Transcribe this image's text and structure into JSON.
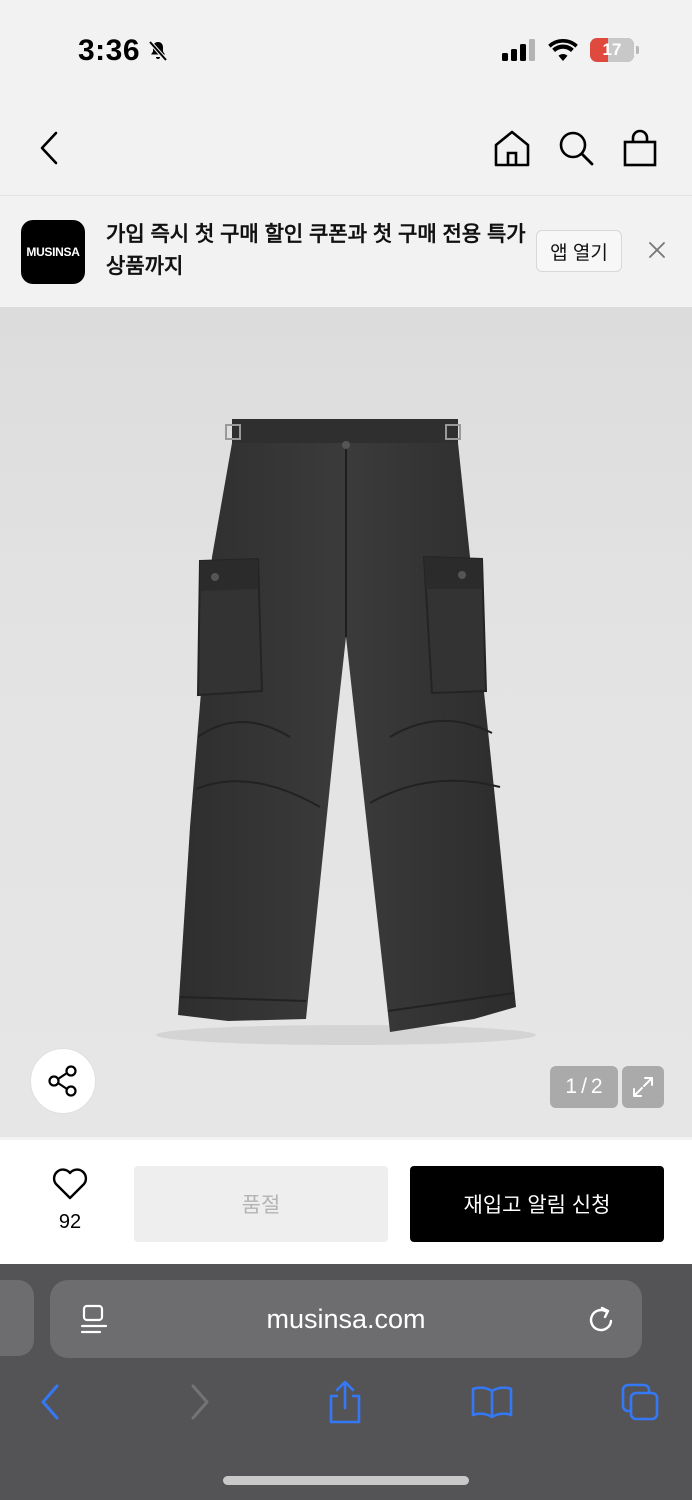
{
  "status_bar": {
    "time": "3:36",
    "battery_level": "17"
  },
  "app_banner": {
    "logo_text": "MUSINSA",
    "message": "가입 즉시 첫 구매 할인 쿠폰과 첫 구매 전용 특가 상품까지",
    "open_app_label": "앱 열기"
  },
  "product": {
    "image_counter_current": "1",
    "image_counter_separator": "/",
    "image_counter_total": "2",
    "image_subject": "dark charcoal cargo pants"
  },
  "purchase_bar": {
    "like_count": "92",
    "soldout_label": "품절",
    "restock_label": "재입고 알림 신청"
  },
  "browser": {
    "url": "musinsa.com",
    "accent_color": "#3478f6"
  },
  "icons": {
    "nav": [
      "back-icon",
      "home-icon",
      "search-icon",
      "bag-icon"
    ],
    "toolbar": [
      "back-arrow-icon",
      "forward-arrow-icon",
      "share-icon",
      "bookmarks-icon",
      "tabs-icon"
    ]
  }
}
